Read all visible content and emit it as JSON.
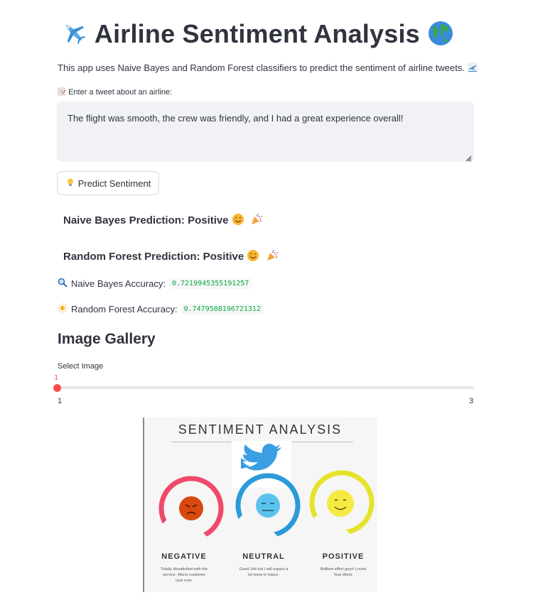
{
  "header": {
    "title": "Airline Sentiment Analysis",
    "icon_left": "airplane-icon",
    "icon_right": "globe-icon"
  },
  "description": "This app uses Naive Bayes and Random Forest classifiers to predict the sentiment of airline tweets.",
  "input": {
    "label": "Enter a tweet about an airline:",
    "value": "The flight was smooth, the crew was friendly, and I had a great experience overall!"
  },
  "button": {
    "label": "Predict Sentiment",
    "icon": "lightbulb-icon"
  },
  "predictions": [
    {
      "text": "Naive Bayes Prediction: Positive"
    },
    {
      "text": "Random Forest Prediction: Positive"
    }
  ],
  "accuracy": [
    {
      "label": "Naive Bayes Accuracy:",
      "value": "0.7219945355191257"
    },
    {
      "label": "Random Forest Accuracy:",
      "value": "0.7479508196721312"
    }
  ],
  "gallery": {
    "heading": "Image Gallery",
    "slider_label": "Select Image",
    "slider_value": "1",
    "slider_min": "1",
    "slider_max": "3"
  },
  "image": {
    "title": "SENTIMENT ANALYSIS",
    "categories": [
      {
        "name": "NEGATIVE",
        "desc": "Totally dissatisfied with the service. Worst customer care ever.",
        "color": "#f0496a",
        "face": "#d9480f"
      },
      {
        "name": "NEUTRAL",
        "desc": "Good Job but I will expect a lot more in future.",
        "color": "#2c9ad9",
        "face": "#5bc2ee"
      },
      {
        "name": "POSITIVE",
        "desc": "Brilliant effort guys! Loved Your Work.",
        "color": "#e7e22a",
        "face": "#f4ea42"
      }
    ]
  },
  "colors": {
    "accent": "#ff4b4b",
    "code_green": "#09ab3b",
    "text": "#31333f"
  }
}
